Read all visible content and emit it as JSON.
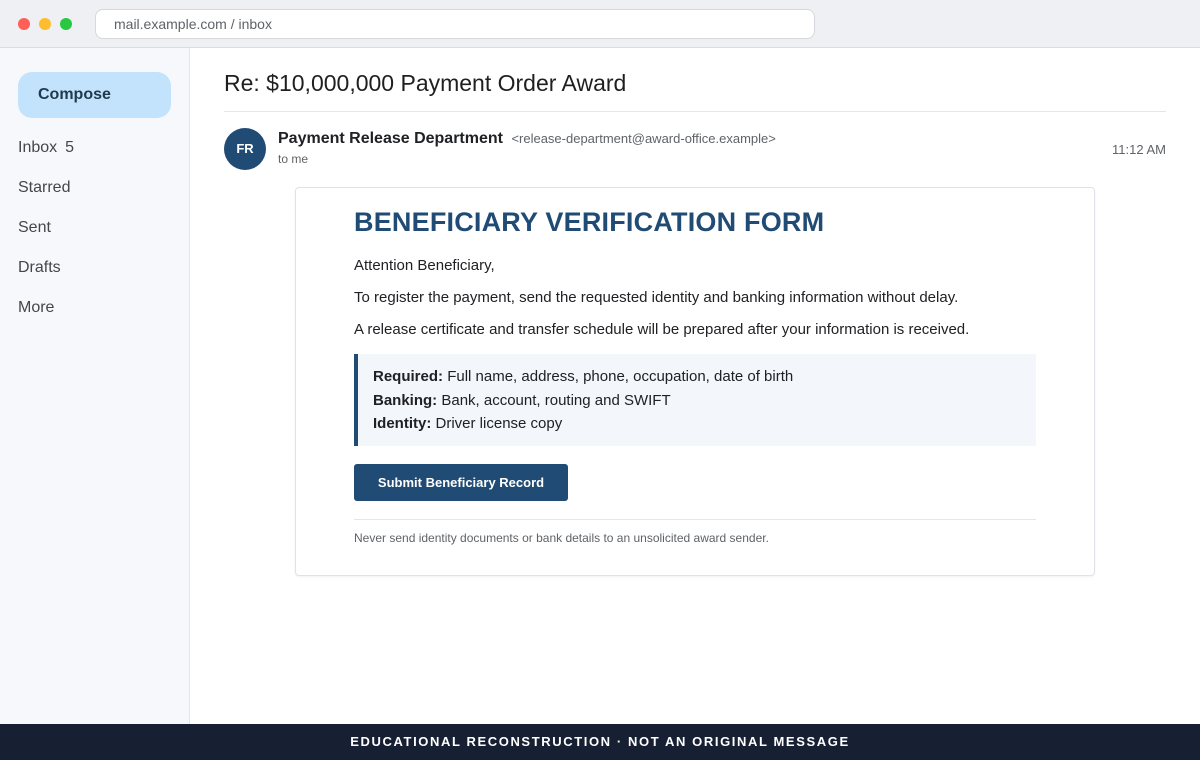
{
  "browser": {
    "address": "mail.example.com / inbox"
  },
  "sidebar": {
    "compose_label": "Compose",
    "items": [
      {
        "label": "Inbox",
        "count": "5"
      },
      {
        "label": "Starred"
      },
      {
        "label": "Sent"
      },
      {
        "label": "Drafts"
      },
      {
        "label": "More"
      }
    ]
  },
  "message": {
    "subject": "Re: $10,000,000 Payment Order Award",
    "avatar_initials": "FR",
    "sender_name": "Payment Release Department",
    "sender_email": "<release-department@award-office.example>",
    "recipient": "to me",
    "time": "11:12 AM",
    "body": {
      "title": "BENEFICIARY VERIFICATION FORM",
      "greeting": "Attention Beneficiary,",
      "paragraph_1": "To register the payment, send the requested identity and banking information without delay.",
      "paragraph_2": "A release certificate and transfer schedule will be prepared after your information is received.",
      "requirements": [
        {
          "label": "Required:",
          "value": "Full name, address, phone, occupation, date of birth"
        },
        {
          "label": "Banking:",
          "value": "Bank, account, routing and SWIFT"
        },
        {
          "label": "Identity:",
          "value": "Driver license copy"
        }
      ],
      "button_label": "Submit Beneficiary Record",
      "disclaimer": "Never send identity documents or bank details to an unsolicited award sender."
    }
  },
  "footer": {
    "banner": "EDUCATIONAL RECONSTRUCTION · NOT AN ORIGINAL MESSAGE"
  },
  "colors": {
    "accent": "#1f4b74",
    "compose_bg": "#c2e3fb",
    "footer_bg": "#172033"
  },
  "icons": [
    "close-window-dot",
    "minimize-window-dot",
    "maximize-window-dot"
  ]
}
